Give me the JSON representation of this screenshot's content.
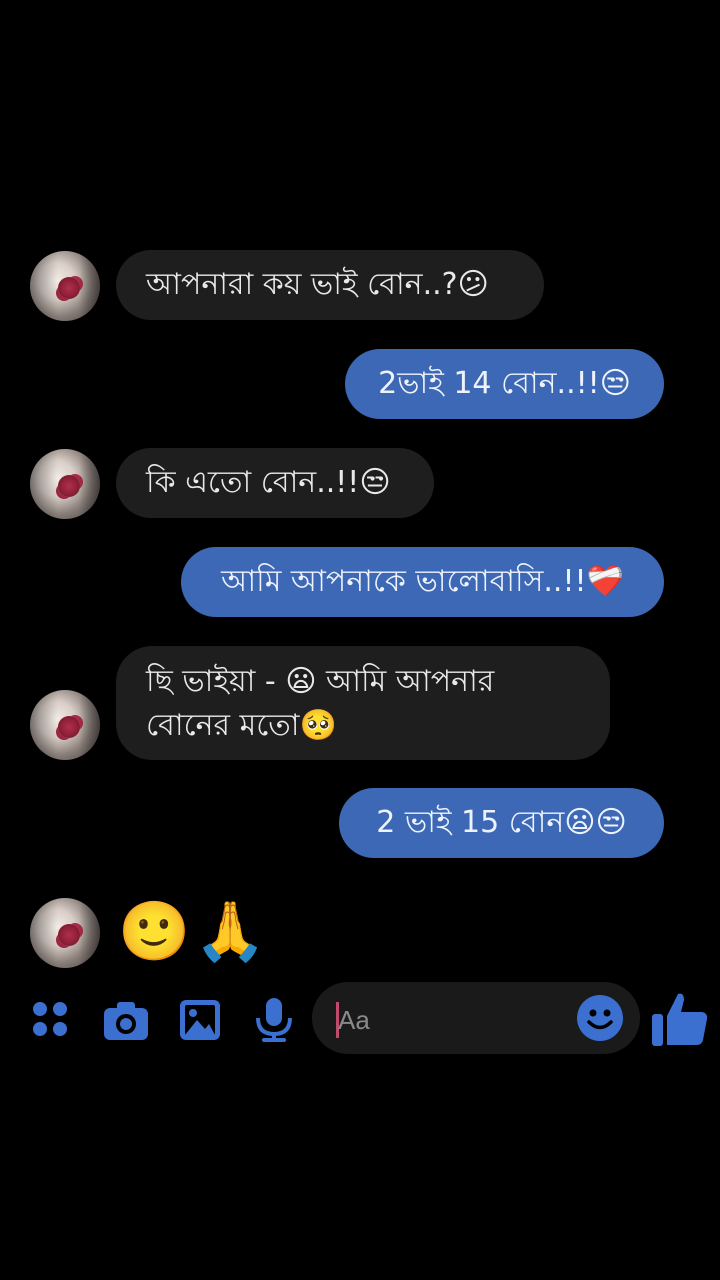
{
  "messages": [
    {
      "side": "in",
      "text": "আপনারা কয় ভাই বোন..?😕"
    },
    {
      "side": "out",
      "text": "2ভাই 14 বোন..!!😒"
    },
    {
      "side": "in",
      "text": "কি এতো বোন..!!😒"
    },
    {
      "side": "out",
      "text": "আমি আপনাকে ভালোবাসি..!!❤️‍🩹"
    },
    {
      "side": "in",
      "text": "ছি ভাইয়া - 😦 আমি আপনার বোনের মতো🥺"
    },
    {
      "side": "out",
      "text": "2 ভাই 15 বোন😦😒"
    },
    {
      "side": "in",
      "text": "🙂🙏"
    }
  ],
  "composer": {
    "placeholder": "Aa",
    "icons": [
      "menu-dots-icon",
      "camera-icon",
      "gallery-icon",
      "microphone-icon",
      "emoji-icon",
      "thumbs-up-icon"
    ]
  },
  "colors": {
    "background": "#000000",
    "incoming_bubble": "#1e1e1e",
    "outgoing_bubble": "#3d68b5",
    "accent_icon": "#3b6fd0"
  }
}
